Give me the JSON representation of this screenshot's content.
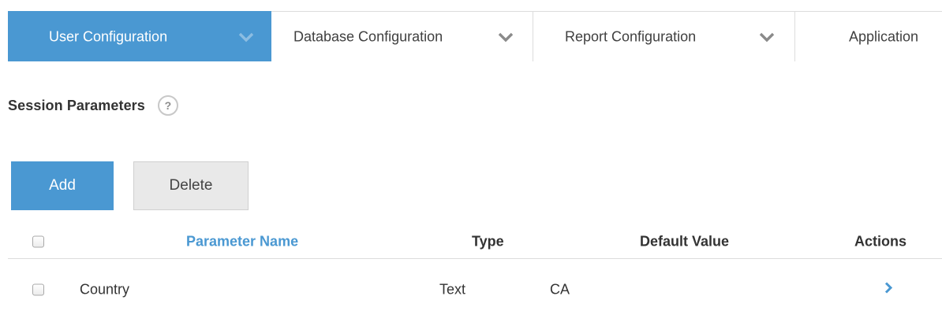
{
  "tabs": [
    {
      "label": "User Configuration",
      "active": true
    },
    {
      "label": "Database Configuration",
      "active": false
    },
    {
      "label": "Report Configuration",
      "active": false
    },
    {
      "label": "Application",
      "active": false
    }
  ],
  "section": {
    "title": "Session Parameters",
    "help_glyph": "?"
  },
  "buttons": {
    "add": "Add",
    "delete": "Delete"
  },
  "table": {
    "headers": {
      "parameter_name": "Parameter Name",
      "type": "Type",
      "default_value": "Default Value",
      "actions": "Actions"
    },
    "rows": [
      {
        "parameter_name": "Country",
        "type": "Text",
        "default_value": "CA",
        "checked": false
      }
    ]
  },
  "icons": {
    "tab_chevron": "chevron-down-icon",
    "help": "help-icon",
    "row_action": "chevron-right-icon"
  },
  "colors": {
    "accent": "#4a98d2",
    "button_secondary": "#e9e9e9",
    "chevron_inactive": "#8a8a8a",
    "chevron_active": "#8cbde2"
  }
}
